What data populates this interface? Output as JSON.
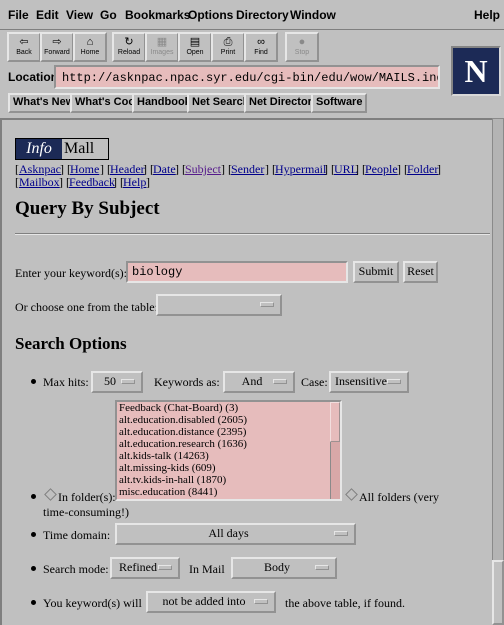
{
  "menubar": {
    "items": [
      "File",
      "Edit",
      "View",
      "Go",
      "Bookmarks",
      "Options",
      "Directory",
      "Window"
    ],
    "help": "Help"
  },
  "toolbar": {
    "back": "Back",
    "forward": "Forward",
    "home": "Home",
    "reload": "Reload",
    "images": "Images",
    "open": "Open",
    "print": "Print",
    "find": "Find",
    "stop": "Stop"
  },
  "location": {
    "label": "Location:",
    "url": "http://asknpac.npac.syr.edu/cgi-bin/edu/wow/MAILS.ind"
  },
  "logo": {
    "letter": "N"
  },
  "directory_buttons": [
    "What's New",
    "What's Cool",
    "Handbook",
    "Net Search",
    "Net Directory",
    "Software"
  ],
  "page": {
    "logo_info": "Info",
    "logo_mall": "Mall",
    "nav_row1": [
      "Asknpac",
      "Home",
      "Header",
      "Date",
      "Subject",
      "Sender",
      "Hypermail",
      "URL",
      "People",
      "Folder"
    ],
    "nav_row2": [
      "Mailbox",
      "Feedback",
      "Help"
    ],
    "title": "Query By Subject",
    "keyword_label": "Enter your keyword(s):",
    "keyword_value": "biology",
    "submit": "Submit",
    "reset": "Reset",
    "choose_label": "Or choose one from the table:",
    "choose_value": "",
    "section_title": "Search Options",
    "max_hits_label": "Max hits:",
    "max_hits_value": "50",
    "keywords_as_label": "Keywords as:",
    "keywords_as_value": "And",
    "case_label": "Case:",
    "case_value": "Insensitive",
    "folders": [
      "Feedback (Chat-Board) (3)",
      "alt.education.disabled (2605)",
      "alt.education.distance (2395)",
      "alt.education.research (1636)",
      "alt.kids-talk (14263)",
      "alt.missing-kids (609)",
      "alt.tv.kids-in-hall (1870)",
      "misc.education (8441)"
    ],
    "in_folders_label": "In folder(s):",
    "all_folders_label": "All folders (very",
    "all_folders_label2": "time-consuming!)",
    "time_domain_label": "Time domain:",
    "time_domain_value": "All days",
    "search_mode_label": "Search mode:",
    "search_mode_value": "Refined",
    "in_mail_label": "In Mail",
    "in_mail_value": "Body",
    "keyword_will_label": "You keyword(s) will",
    "keyword_will_value": "not be added into",
    "keyword_will_suffix": "the above table, if found."
  }
}
